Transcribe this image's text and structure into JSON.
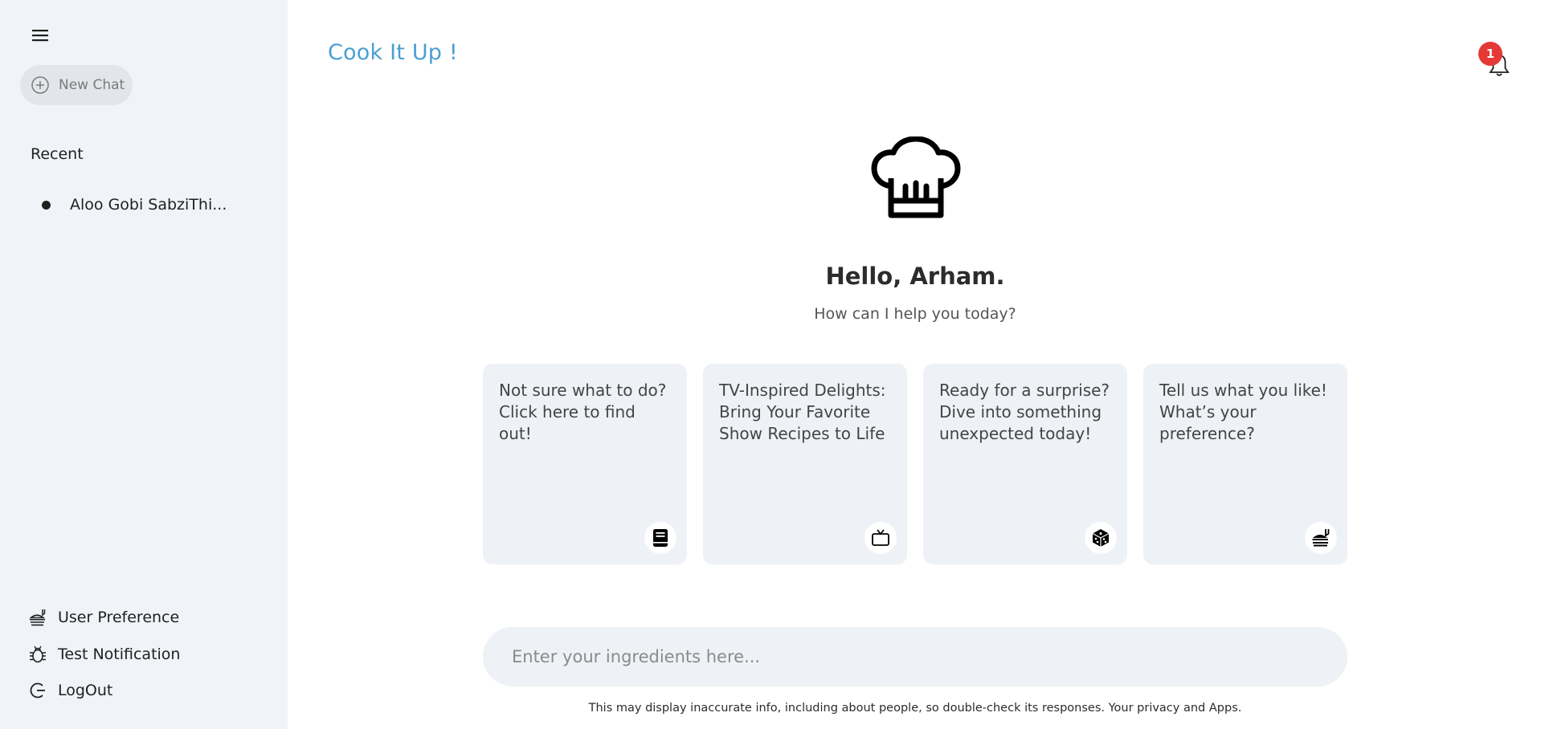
{
  "sidebar": {
    "new_chat_label": "New Chat",
    "recent_title": "Recent",
    "recent_items": [
      {
        "label": "Aloo Gobi SabziThi..."
      }
    ],
    "bottom_items": [
      {
        "label": "User Preference",
        "icon": "food-icon"
      },
      {
        "label": "Test Notification",
        "icon": "bug-icon"
      },
      {
        "label": "LogOut",
        "icon": "logout-icon"
      }
    ]
  },
  "header": {
    "brand": "Cook It Up !",
    "notification_count": "1"
  },
  "main": {
    "greeting": "Hello, Arham.",
    "subtitle": "How can I help you today?",
    "cards": [
      {
        "text": "Not sure what to do? Click here to find out!",
        "icon": "book-icon"
      },
      {
        "text": "TV-Inspired Delights: Bring Your Favorite Show Recipes to Life",
        "icon": "tv-icon"
      },
      {
        "text": "Ready for a surprise? Dive into something unexpected today!",
        "icon": "dice-icon"
      },
      {
        "text": "Tell us what you like! What’s your preference?",
        "icon": "food-icon"
      }
    ],
    "input_placeholder": "Enter your ingredients here...",
    "disclaimer": "This may display inaccurate info, including about people, so double-check its responses. Your privacy and Apps."
  },
  "colors": {
    "sidebar_bg": "#f0f3f7",
    "brand": "#4a9fd3",
    "badge": "#e53935",
    "card_bg": "#eef1f5"
  }
}
